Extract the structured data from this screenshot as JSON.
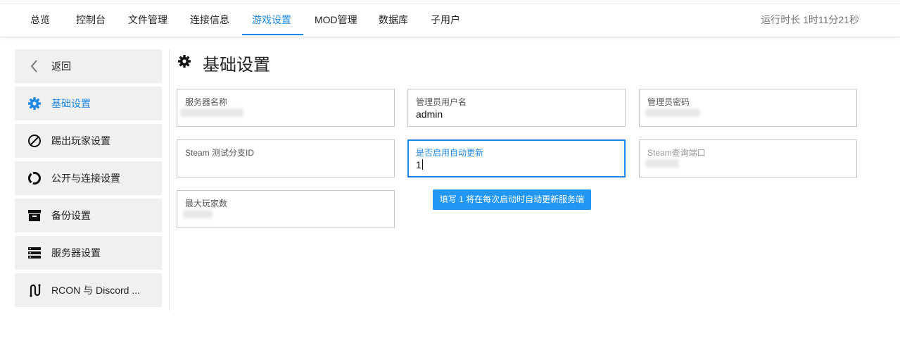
{
  "nav": {
    "tabs": [
      {
        "label": "总览"
      },
      {
        "label": "控制台"
      },
      {
        "label": "文件管理"
      },
      {
        "label": "连接信息"
      },
      {
        "label": "游戏设置",
        "active": true
      },
      {
        "label": "MOD管理"
      },
      {
        "label": "数据库"
      },
      {
        "label": "子用户"
      }
    ],
    "uptime": "运行时长 1时11分21秒"
  },
  "sidebar": {
    "items": [
      {
        "label": "返回",
        "icon": "back-icon"
      },
      {
        "label": "基础设置",
        "icon": "gear-icon",
        "active": true
      },
      {
        "label": "踢出玩家设置",
        "icon": "ban-icon"
      },
      {
        "label": "公开与连接设置",
        "icon": "connection-icon"
      },
      {
        "label": "备份设置",
        "icon": "archive-icon"
      },
      {
        "label": "服务器设置",
        "icon": "server-icon"
      },
      {
        "label": "RCON 与 Discord ...",
        "icon": "route-icon"
      }
    ]
  },
  "main": {
    "title": "基础设置",
    "fields": {
      "server_name": {
        "label": "服务器名称",
        "value": ""
      },
      "admin_username": {
        "label": "管理员用户名",
        "value": "admin"
      },
      "admin_password": {
        "label": "管理员密码",
        "value": ""
      },
      "steam_branch": {
        "label": "Steam 测试分支ID",
        "value": ""
      },
      "auto_update": {
        "label": "是否启用自动更新",
        "value": "1"
      },
      "steam_query_port": {
        "label": "Steam查询端口",
        "value": ""
      },
      "max_players": {
        "label": "最大玩家数",
        "value": ""
      }
    },
    "tooltip": "填写 1 将在每次启动时自动更新服务端"
  },
  "colors": {
    "accent": "#1e88e5",
    "tooltip_bg": "#2196f3",
    "sidebar_bg": "#f0f0f0"
  }
}
